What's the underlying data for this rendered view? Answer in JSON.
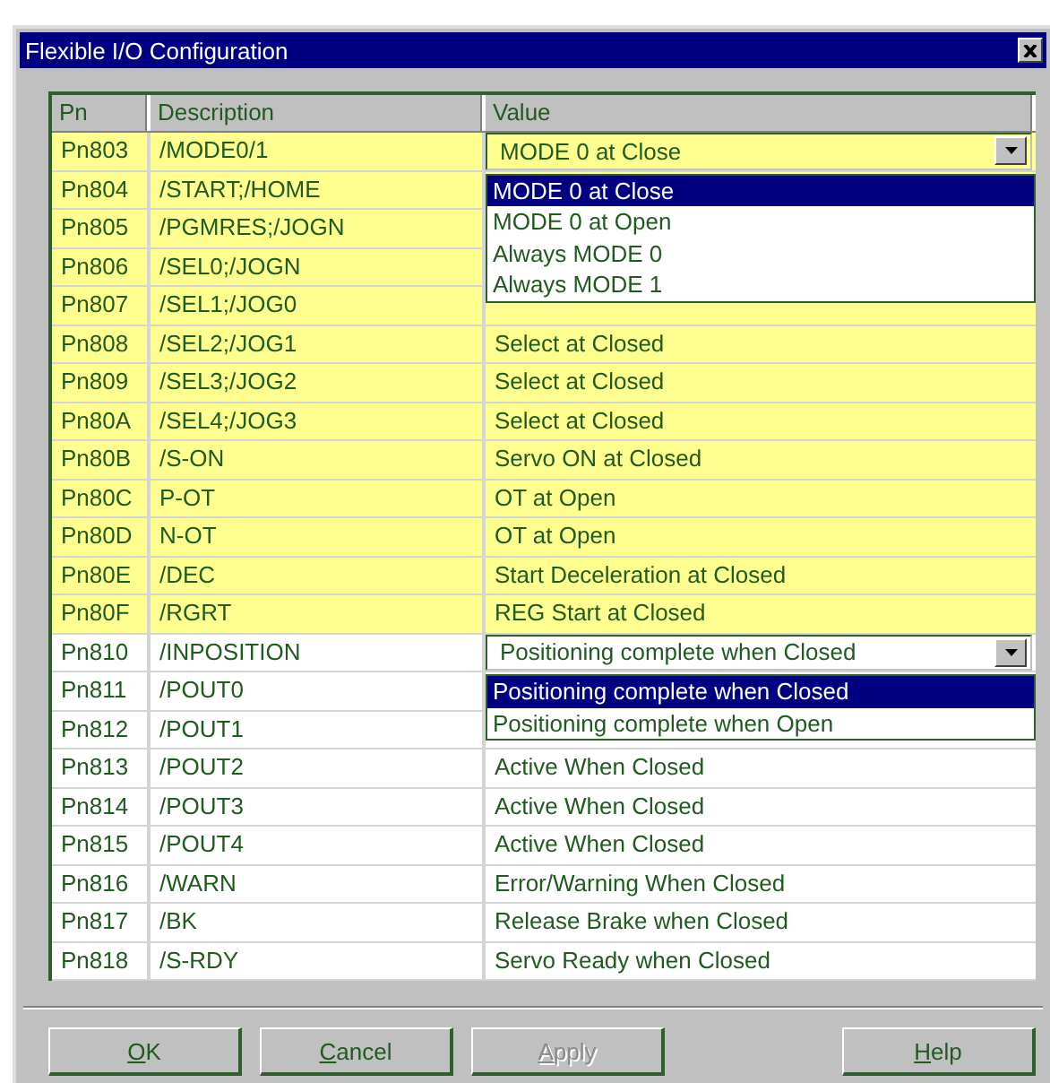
{
  "window": {
    "title": "Flexible I/O Configuration"
  },
  "table": {
    "columns": [
      "Pn",
      "Description",
      "Value"
    ],
    "rows": [
      {
        "pn": "Pn803",
        "description": "/MODE0/1",
        "highlighted": true,
        "dropdown": {
          "value": "MODE 0 at Close",
          "options": [
            {
              "label": "MODE 0 at Close",
              "selected": true
            },
            {
              "label": "MODE 0 at Open",
              "selected": false
            },
            {
              "label": "Always MODE 0",
              "selected": false
            },
            {
              "label": "Always MODE 1",
              "selected": false
            }
          ]
        }
      },
      {
        "pn": "Pn804",
        "description": "/START;/HOME",
        "highlighted": true
      },
      {
        "pn": "Pn805",
        "description": "/PGMRES;/JOGN",
        "highlighted": true
      },
      {
        "pn": "Pn806",
        "description": "/SEL0;/JOGN",
        "highlighted": true
      },
      {
        "pn": "Pn807",
        "description": "/SEL1;/JOG0",
        "highlighted": true
      },
      {
        "pn": "Pn808",
        "description": "/SEL2;/JOG1",
        "highlighted": true,
        "value": "Select at Closed"
      },
      {
        "pn": "Pn809",
        "description": "/SEL3;/JOG2",
        "highlighted": true,
        "value": "Select at Closed"
      },
      {
        "pn": "Pn80A",
        "description": "/SEL4;/JOG3",
        "highlighted": true,
        "value": "Select at Closed"
      },
      {
        "pn": "Pn80B",
        "description": "/S-ON",
        "highlighted": true,
        "value": "Servo ON at Closed"
      },
      {
        "pn": "Pn80C",
        "description": "P-OT",
        "highlighted": true,
        "value": "OT at Open"
      },
      {
        "pn": "Pn80D",
        "description": "N-OT",
        "highlighted": true,
        "value": "OT at Open"
      },
      {
        "pn": "Pn80E",
        "description": "/DEC",
        "highlighted": true,
        "value": "Start Deceleration at Closed"
      },
      {
        "pn": "Pn80F",
        "description": "/RGRT",
        "highlighted": true,
        "value": "REG Start at Closed"
      },
      {
        "pn": "Pn810",
        "description": "/INPOSITION",
        "highlighted": false,
        "dropdown": {
          "value": "Positioning complete when Closed",
          "options": [
            {
              "label": "Positioning complete when Closed",
              "selected": true
            },
            {
              "label": "Positioning complete when Open",
              "selected": false
            }
          ]
        }
      },
      {
        "pn": "Pn811",
        "description": "/POUT0",
        "highlighted": false
      },
      {
        "pn": "Pn812",
        "description": "/POUT1",
        "highlighted": false
      },
      {
        "pn": "Pn813",
        "description": "/POUT2",
        "highlighted": false,
        "value": "Active When Closed"
      },
      {
        "pn": "Pn814",
        "description": "/POUT3",
        "highlighted": false,
        "value": "Active When Closed"
      },
      {
        "pn": "Pn815",
        "description": "/POUT4",
        "highlighted": false,
        "value": "Active When Closed"
      },
      {
        "pn": "Pn816",
        "description": "/WARN",
        "highlighted": false,
        "value": "Error/Warning When Closed"
      },
      {
        "pn": "Pn817",
        "description": "/BK",
        "highlighted": false,
        "value": "Release Brake when Closed"
      },
      {
        "pn": "Pn818",
        "description": "/S-RDY",
        "highlighted": false,
        "value": "Servo Ready when Closed"
      }
    ]
  },
  "buttons": [
    {
      "accel": "O",
      "rest": "K",
      "disabled": false
    },
    {
      "accel": "C",
      "rest": "ancel",
      "disabled": false
    },
    {
      "accel": "A",
      "rest": "pply",
      "disabled": true
    },
    {
      "accel": "H",
      "rest": "elp",
      "disabled": false
    }
  ]
}
